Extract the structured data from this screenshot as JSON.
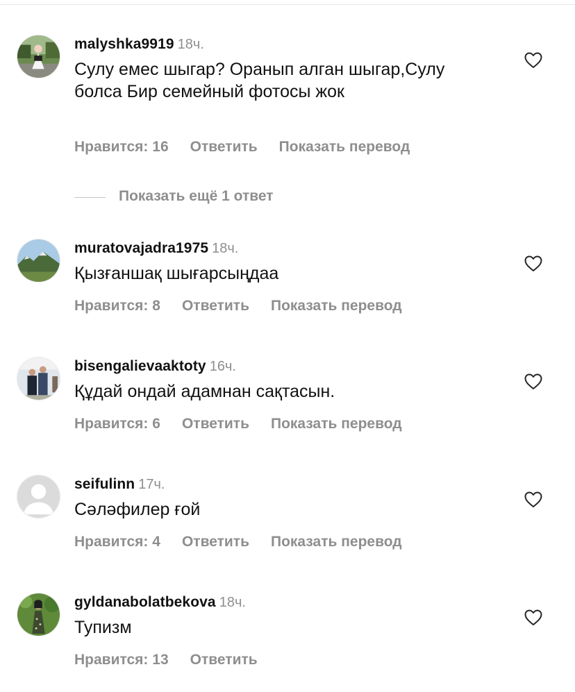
{
  "comments": [
    {
      "username": "malyshka9919",
      "time": "18ч.",
      "text": "Сулу емес шыгар? Оранып алган шыгар,Сулу болса Бир семейный фотосы жок",
      "likes": "Нравится: 16",
      "reply": "Ответить",
      "translate": "Показать перевод",
      "avatar_icon": "user-avatar-photo"
    },
    {
      "username": "muratovajadra1975",
      "time": "18ч.",
      "text": "Қызғаншақ шығарсыңдаа",
      "likes": "Нравится: 8",
      "reply": "Ответить",
      "translate": "Показать перевод",
      "avatar_icon": "user-avatar-photo"
    },
    {
      "username": "bisengalievaaktoty",
      "time": "16ч.",
      "text": "Құдай ондай адамнан сақтасын.",
      "likes": "Нравится: 6",
      "reply": "Ответить",
      "translate": "Показать перевод",
      "avatar_icon": "user-avatar-photo"
    },
    {
      "username": "seifulinn",
      "time": "17ч.",
      "text": "Сәләфилер ғой",
      "likes": "Нравится: 4",
      "reply": "Ответить",
      "translate": "Показать перевод",
      "avatar_icon": "default-avatar-icon"
    },
    {
      "username": "gyldanabolatbekova",
      "time": "18ч.",
      "text": "Тупизм",
      "likes": "Нравится: 13",
      "reply": "Ответить",
      "avatar_icon": "user-avatar-photo"
    }
  ],
  "more_replies": "Показать ещё 1 ответ",
  "icons": {
    "like": "heart-icon"
  },
  "colors": {
    "text": "#111111",
    "secondary": "#8e8e8e",
    "divider": "#c7c7c7"
  }
}
